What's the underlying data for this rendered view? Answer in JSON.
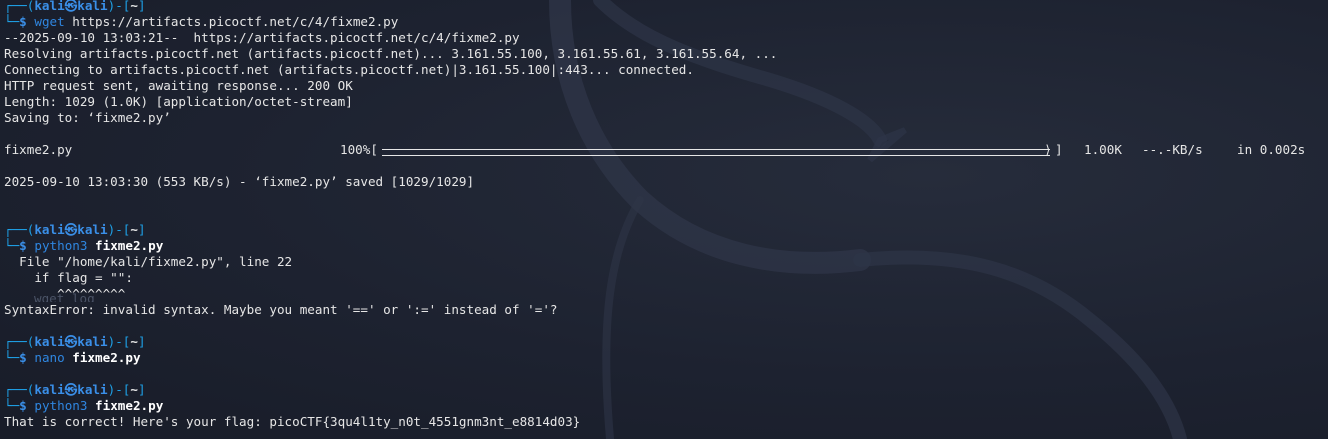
{
  "prompt": {
    "open": "┌──(",
    "user": "kali㉿kali",
    "mid": ")-[",
    "cwd": "~",
    "close": "]",
    "corner": "└─",
    "dollar": "$"
  },
  "blocks": [
    {
      "command": "wget",
      "args": "https://artifacts.picoctf.net/c/4/fixme2.py",
      "output": [
        "--2025-09-10 13:03:21--  https://artifacts.picoctf.net/c/4/fixme2.py",
        "Resolving artifacts.picoctf.net (artifacts.picoctf.net)... 3.161.55.100, 3.161.55.61, 3.161.55.64, ...",
        "Connecting to artifacts.picoctf.net (artifacts.picoctf.net)|3.161.55.100|:443... connected.",
        "HTTP request sent, awaiting response... 200 OK",
        "Length: 1029 (1.0K) [application/octet-stream]",
        "Saving to: ‘fixme2.py’"
      ],
      "progress": {
        "filename": "fixme2.py",
        "percent_label": "100%[",
        "percent": 100,
        "bar_end": "]",
        "size": "1.00K",
        "rate": "--.-KB/s",
        "time": "in 0.002s"
      },
      "saved": "2025-09-10 13:03:30 (553 KB/s) - ‘fixme2.py’ saved [1029/1029]"
    },
    {
      "command": "python3",
      "args": "fixme2.py",
      "output": [
        "  File \"/home/kali/fixme2.py\", line 22",
        "    if flag = \"\":",
        "       ^^^^^^^^^",
        "SyntaxError: invalid syntax. Maybe you meant '==' or ':=' instead of '='?"
      ]
    },
    {
      "command": "nano",
      "args": "fixme2.py",
      "output": []
    },
    {
      "command": "python3",
      "args": "fixme2.py",
      "output": [
        "That is correct! Here's your flag: picoCTF{3qu4l1ty_n0t_4551gnm3nt_e8814d03}"
      ]
    }
  ],
  "ghost_text": "wget log",
  "colors": {
    "background": "#1c2130",
    "prompt_blue": "#1ea0e6",
    "command_blue": "#2f86e0"
  }
}
